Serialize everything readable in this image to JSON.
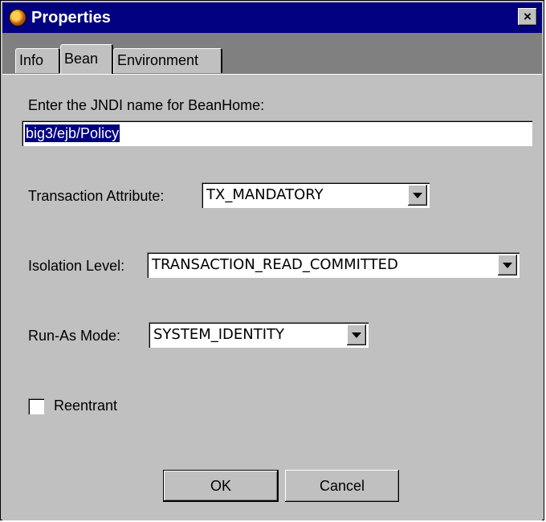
{
  "window": {
    "title": "Properties",
    "close_glyph": "×"
  },
  "tabs": [
    {
      "label": "Info",
      "active": false
    },
    {
      "label": "Bean",
      "active": true
    },
    {
      "label": "Environment",
      "active": false
    }
  ],
  "form": {
    "jndi_label": "Enter the JNDI name for BeanHome:",
    "jndi_value": "big3/ejb/Policy",
    "transaction_label": "Transaction Attribute:",
    "transaction_value": "TX_MANDATORY",
    "isolation_label": "Isolation Level:",
    "isolation_value": "TRANSACTION_READ_COMMITTED",
    "runas_label": "Run-As Mode:",
    "runas_value": "SYSTEM_IDENTITY",
    "reentrant_label": "Reentrant",
    "reentrant_checked": false
  },
  "buttons": {
    "ok_label": "OK",
    "cancel_label": "Cancel"
  },
  "colors": {
    "titlebar": "#000080",
    "face": "#c0c0c0",
    "tabstrip": "#808080",
    "selection": "#000080"
  }
}
